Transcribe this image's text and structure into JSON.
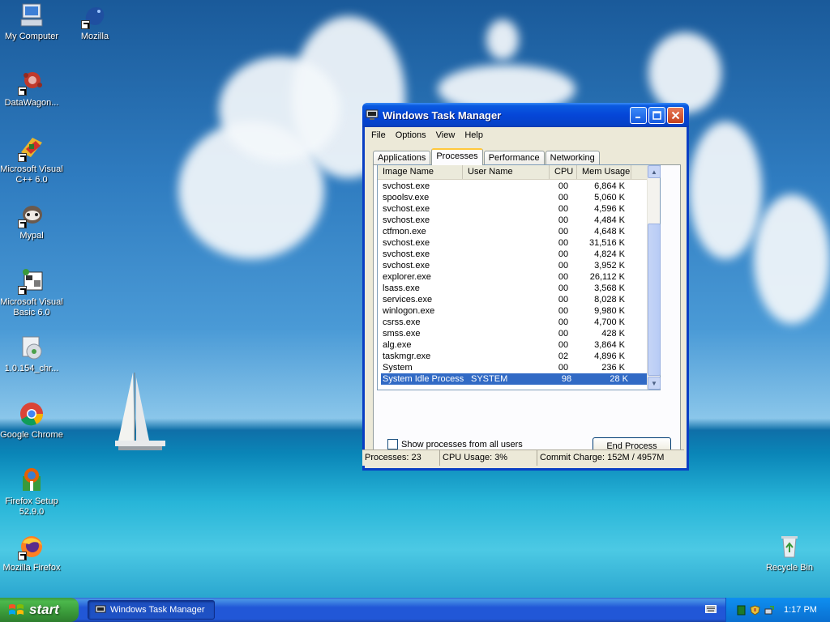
{
  "desktop": {
    "icons": [
      {
        "label": "My Computer"
      },
      {
        "label": "Mozilla"
      },
      {
        "label": "DataWagon..."
      },
      {
        "label": "Microsoft Visual C++ 6.0"
      },
      {
        "label": "Mypal"
      },
      {
        "label": "Microsoft Visual Basic 6.0"
      },
      {
        "label": "1.0.154_chr..."
      },
      {
        "label": "Google Chrome"
      },
      {
        "label": "Firefox Setup 52.9.0"
      },
      {
        "label": "Mozilla Firefox"
      },
      {
        "label": "Recycle Bin"
      }
    ]
  },
  "window": {
    "title": "Windows Task Manager",
    "menu": [
      "File",
      "Options",
      "View",
      "Help"
    ],
    "tabs": [
      "Applications",
      "Processes",
      "Performance",
      "Networking"
    ],
    "active_tab": "Processes",
    "columns": [
      "Image Name",
      "User Name",
      "CPU",
      "Mem Usage"
    ],
    "rows": [
      {
        "name": "svchost.exe",
        "user": "",
        "cpu": "00",
        "mem": "6,864 K"
      },
      {
        "name": "spoolsv.exe",
        "user": "",
        "cpu": "00",
        "mem": "5,060 K"
      },
      {
        "name": "svchost.exe",
        "user": "",
        "cpu": "00",
        "mem": "4,596 K"
      },
      {
        "name": "svchost.exe",
        "user": "",
        "cpu": "00",
        "mem": "4,484 K"
      },
      {
        "name": "ctfmon.exe",
        "user": "",
        "cpu": "00",
        "mem": "4,648 K"
      },
      {
        "name": "svchost.exe",
        "user": "",
        "cpu": "00",
        "mem": "31,516 K"
      },
      {
        "name": "svchost.exe",
        "user": "",
        "cpu": "00",
        "mem": "4,824 K"
      },
      {
        "name": "svchost.exe",
        "user": "",
        "cpu": "00",
        "mem": "3,952 K"
      },
      {
        "name": "explorer.exe",
        "user": "",
        "cpu": "00",
        "mem": "26,112 K"
      },
      {
        "name": "lsass.exe",
        "user": "",
        "cpu": "00",
        "mem": "3,568 K"
      },
      {
        "name": "services.exe",
        "user": "",
        "cpu": "00",
        "mem": "8,028 K"
      },
      {
        "name": "winlogon.exe",
        "user": "",
        "cpu": "00",
        "mem": "9,980 K"
      },
      {
        "name": "csrss.exe",
        "user": "",
        "cpu": "00",
        "mem": "4,700 K"
      },
      {
        "name": "smss.exe",
        "user": "",
        "cpu": "00",
        "mem": "428 K"
      },
      {
        "name": "alg.exe",
        "user": "",
        "cpu": "00",
        "mem": "3,864 K"
      },
      {
        "name": "taskmgr.exe",
        "user": "",
        "cpu": "02",
        "mem": "4,896 K"
      },
      {
        "name": "System",
        "user": "",
        "cpu": "00",
        "mem": "236 K"
      },
      {
        "name": "System Idle Process",
        "user": "SYSTEM",
        "cpu": "98",
        "mem": "28 K",
        "selected": true
      }
    ],
    "show_all_label": "Show processes from all users",
    "show_all_checked": false,
    "end_process_label": "End Process",
    "status": {
      "processes": "Processes: 23",
      "cpu": "CPU Usage: 3%",
      "commit": "Commit Charge: 152M / 4957M"
    }
  },
  "taskbar": {
    "start_label": "start",
    "task_button_label": "Windows Task Manager",
    "clock": "1:17 PM"
  },
  "icons": {
    "title": "task-manager-icon",
    "tray": [
      "network-icon",
      "security-shield-icon",
      "safely-remove-icon"
    ]
  },
  "colors": {
    "titlebar": "#0546d8",
    "selection": "#316ac5",
    "taskbar": "#2157d7",
    "start": "#3a9a3a"
  }
}
